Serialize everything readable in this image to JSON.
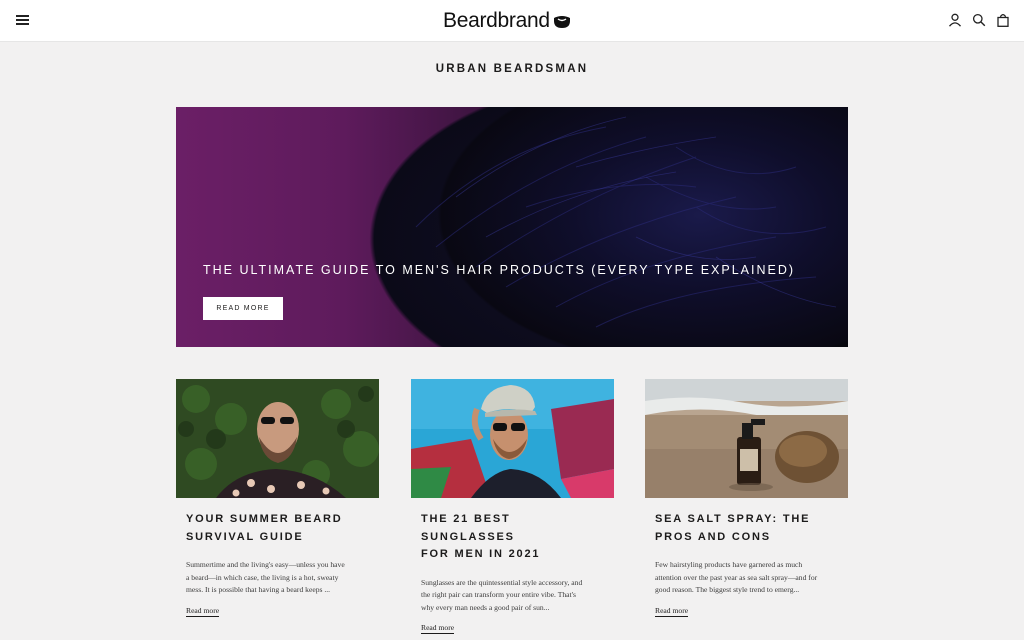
{
  "header": {
    "brand": "Beardbrand",
    "icons": [
      "menu-icon",
      "account-icon",
      "search-icon",
      "cart-icon"
    ]
  },
  "page": {
    "title": "URBAN BEARDSMAN"
  },
  "hero": {
    "title": "THE ULTIMATE GUIDE TO MEN'S HAIR PRODUCTS (EVERY TYPE EXPLAINED)",
    "button_label": "READ MORE"
  },
  "articles": [
    {
      "title_line1": "YOUR SUMMER BEARD",
      "title_line2": "SURVIVAL GUIDE",
      "excerpt_line1": "Summertime and the living's easy—unless you have",
      "excerpt_line2": "a beard—in which case, the living is a hot, sweaty",
      "excerpt_line3": "mess. It is possible that having a beard keeps ...",
      "link_label": "Read more"
    },
    {
      "title_line1": "THE 21 BEST SUNGLASSES",
      "title_line2": "FOR MEN IN 2021",
      "excerpt_line1": "Sunglasses are the quintessential style accessory, and",
      "excerpt_line2": "the right pair can transform your entire vibe. That's",
      "excerpt_line3": "why every man needs a good pair of sun...",
      "link_label": "Read more"
    },
    {
      "title_line1": "SEA SALT SPRAY: THE",
      "title_line2": "PROS AND CONS",
      "excerpt_line1": "Few hairstyling products have garnered as much",
      "excerpt_line2": "attention over the past year as sea salt spray—and for",
      "excerpt_line3": "good reason. The biggest style trend to emerg...",
      "link_label": "Read more"
    }
  ],
  "colors": {
    "background": "#f2f1f1",
    "text": "#1c1b1b",
    "hero_purple": "#6b1f66",
    "hero_dark": "#07070d"
  }
}
